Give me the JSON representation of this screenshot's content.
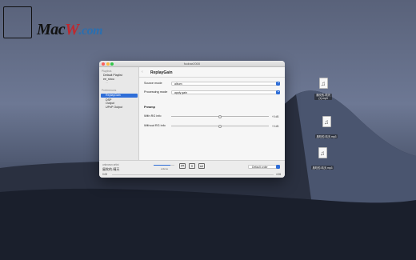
{
  "watermark": {
    "brand_main": "Mac",
    "brand_accent": "W",
    "brand_suffix": ".com"
  },
  "window": {
    "title": "foobar2000",
    "sidebar": {
      "playlists_header": "Playlists",
      "playlists": [
        "Default Playlist",
        "ee_shou"
      ],
      "playlist_sub": "...",
      "preferences_header": "Preferences",
      "selected": "ReplayGain",
      "items": [
        "DSP",
        "Output",
        "UPnP Output"
      ]
    },
    "page": {
      "title": "ReplayGain",
      "back_icon": "chevron-left-icon",
      "source_mode_label": "Source mode",
      "source_mode_value": "album",
      "processing_mode_label": "Processing mode",
      "processing_mode_value": "apply gain",
      "preamp_title": "Preamp",
      "with_rg_label": "With RG info",
      "with_rg_value": "+0 dB",
      "with_rg_level": 0.5,
      "without_rg_label": "Without RG info",
      "without_rg_value": "+0 dB",
      "without_rg_level": 0.5
    },
    "player": {
      "artist": "unknown artist",
      "song": "風吹的-晴天",
      "time_elapsed": "0:00",
      "time_total": "4:26",
      "volume_label": "volume",
      "volume_level": 0.8,
      "order_label": "Default order",
      "prev_icon": "skip-back-icon",
      "pause_icon": "pause-icon",
      "next_icon": "skip-forward-icon"
    }
  },
  "desktop_files": [
    {
      "name": "風吹的-晴天\n(1).mp3",
      "icon": "music-file-icon"
    },
    {
      "name": "風吹的-晴天.mp3",
      "icon": "music-file-icon"
    },
    {
      "name": "風吹的-晴天.mp3",
      "icon": "music-file-icon"
    }
  ],
  "colors": {
    "accent": "#2f6ed8",
    "traffic_red": "#fc605c",
    "traffic_yellow": "#fdbc40",
    "traffic_green": "#34c84a"
  }
}
